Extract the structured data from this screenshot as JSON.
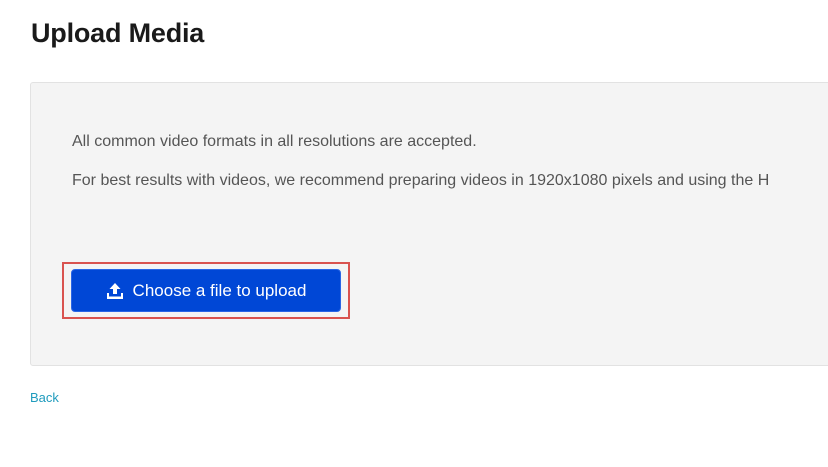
{
  "page": {
    "title": "Upload Media"
  },
  "upload_panel": {
    "info_line_1": "All common video formats in all resolutions are accepted.",
    "info_line_2": "For best results with videos, we recommend preparing videos in 1920x1080 pixels and using the H",
    "upload_button_label": "Choose a file to upload",
    "upload_icon": "upload-icon"
  },
  "footer": {
    "back_label": "Back"
  },
  "colors": {
    "button_bg": "#0047d6",
    "highlight_border": "#d9534f",
    "link": "#1f9bbd",
    "panel_bg": "#f4f4f4"
  }
}
